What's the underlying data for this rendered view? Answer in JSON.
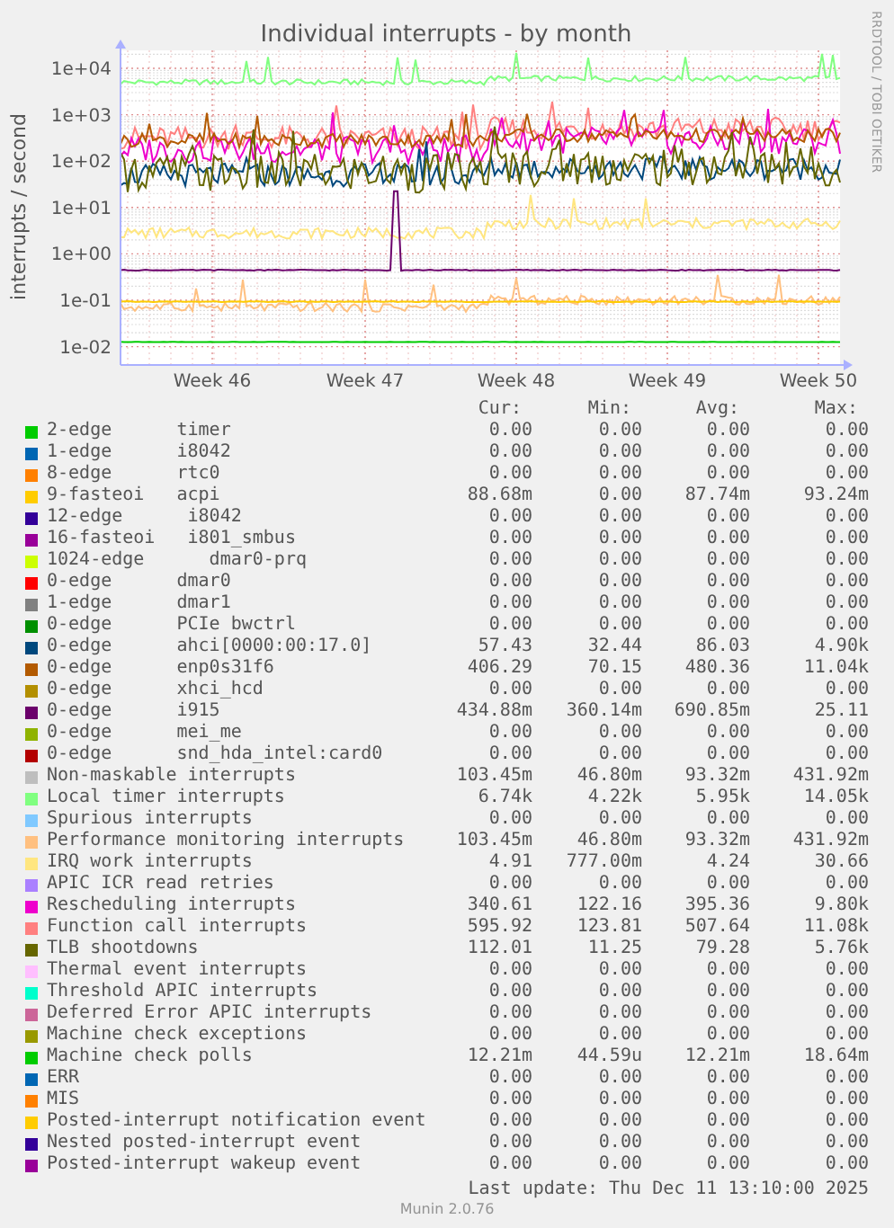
{
  "graph": {
    "title": "Individual interrupts - by month",
    "ylabel": "interrupts / second",
    "side_credit": "RRDTOOL / TOBI OETIKER",
    "yticks": [
      "1e+04",
      "1e+03",
      "1e+02",
      "1e+01",
      "1e+00",
      "1e-01",
      "1e-02"
    ],
    "xticks": [
      "Week 46",
      "Week 47",
      "Week 48",
      "Week 49",
      "Week 50"
    ]
  },
  "legend": {
    "columns": [
      "Cur:",
      "Min:",
      "Avg:",
      "Max:"
    ],
    "rows": [
      {
        "color": "#00cc00",
        "label": "2-edge      timer",
        "cur": "0.00",
        "min": "0.00",
        "avg": "0.00",
        "max": "0.00"
      },
      {
        "color": "#0066b3",
        "label": "1-edge      i8042",
        "cur": "0.00",
        "min": "0.00",
        "avg": "0.00",
        "max": "0.00"
      },
      {
        "color": "#ff8000",
        "label": "8-edge      rtc0",
        "cur": "0.00",
        "min": "0.00",
        "avg": "0.00",
        "max": "0.00"
      },
      {
        "color": "#ffcc00",
        "label": "9-fasteoi   acpi",
        "cur": "88.68m",
        "min": "0.00",
        "avg": "87.74m",
        "max": "93.24m"
      },
      {
        "color": "#330099",
        "label": "12-edge      i8042",
        "cur": "0.00",
        "min": "0.00",
        "avg": "0.00",
        "max": "0.00"
      },
      {
        "color": "#990099",
        "label": "16-fasteoi   i801_smbus",
        "cur": "0.00",
        "min": "0.00",
        "avg": "0.00",
        "max": "0.00"
      },
      {
        "color": "#ccff00",
        "label": "1024-edge      dmar0-prq",
        "cur": "0.00",
        "min": "0.00",
        "avg": "0.00",
        "max": "0.00"
      },
      {
        "color": "#ff0000",
        "label": "0-edge      dmar0",
        "cur": "0.00",
        "min": "0.00",
        "avg": "0.00",
        "max": "0.00"
      },
      {
        "color": "#808080",
        "label": "1-edge      dmar1",
        "cur": "0.00",
        "min": "0.00",
        "avg": "0.00",
        "max": "0.00"
      },
      {
        "color": "#008f00",
        "label": "0-edge      PCIe bwctrl",
        "cur": "0.00",
        "min": "0.00",
        "avg": "0.00",
        "max": "0.00"
      },
      {
        "color": "#00487d",
        "label": "0-edge      ahci[0000:00:17.0]",
        "cur": "57.43",
        "min": "32.44",
        "avg": "86.03",
        "max": "4.90k"
      },
      {
        "color": "#b35a00",
        "label": "0-edge      enp0s31f6",
        "cur": "406.29",
        "min": "70.15",
        "avg": "480.36",
        "max": "11.04k"
      },
      {
        "color": "#b38f00",
        "label": "0-edge      xhci_hcd",
        "cur": "0.00",
        "min": "0.00",
        "avg": "0.00",
        "max": "0.00"
      },
      {
        "color": "#6b006b",
        "label": "0-edge      i915",
        "cur": "434.88m",
        "min": "360.14m",
        "avg": "690.85m",
        "max": "25.11"
      },
      {
        "color": "#8fb300",
        "label": "0-edge      mei_me",
        "cur": "0.00",
        "min": "0.00",
        "avg": "0.00",
        "max": "0.00"
      },
      {
        "color": "#b30000",
        "label": "0-edge      snd_hda_intel:card0",
        "cur": "0.00",
        "min": "0.00",
        "avg": "0.00",
        "max": "0.00"
      },
      {
        "color": "#bebebe",
        "label": "Non-maskable interrupts",
        "cur": "103.45m",
        "min": "46.80m",
        "avg": "93.32m",
        "max": "431.92m"
      },
      {
        "color": "#80ff80",
        "label": "Local timer interrupts",
        "cur": "6.74k",
        "min": "4.22k",
        "avg": "5.95k",
        "max": "14.05k"
      },
      {
        "color": "#80c9ff",
        "label": "Spurious interrupts",
        "cur": "0.00",
        "min": "0.00",
        "avg": "0.00",
        "max": "0.00"
      },
      {
        "color": "#ffc080",
        "label": "Performance monitoring interrupts",
        "cur": "103.45m",
        "min": "46.80m",
        "avg": "93.32m",
        "max": "431.92m"
      },
      {
        "color": "#ffe680",
        "label": "IRQ work interrupts",
        "cur": "4.91",
        "min": "777.00m",
        "avg": "4.24",
        "max": "30.66"
      },
      {
        "color": "#aa80ff",
        "label": "APIC ICR read retries",
        "cur": "0.00",
        "min": "0.00",
        "avg": "0.00",
        "max": "0.00"
      },
      {
        "color": "#ee00cc",
        "label": "Rescheduling interrupts",
        "cur": "340.61",
        "min": "122.16",
        "avg": "395.36",
        "max": "9.80k"
      },
      {
        "color": "#ff8080",
        "label": "Function call interrupts",
        "cur": "595.92",
        "min": "123.81",
        "avg": "507.64",
        "max": "11.08k"
      },
      {
        "color": "#666600",
        "label": "TLB shootdowns",
        "cur": "112.01",
        "min": "11.25",
        "avg": "79.28",
        "max": "5.76k"
      },
      {
        "color": "#ffbfff",
        "label": "Thermal event interrupts",
        "cur": "0.00",
        "min": "0.00",
        "avg": "0.00",
        "max": "0.00"
      },
      {
        "color": "#00ffcc",
        "label": "Threshold APIC interrupts",
        "cur": "0.00",
        "min": "0.00",
        "avg": "0.00",
        "max": "0.00"
      },
      {
        "color": "#cc6699",
        "label": "Deferred Error APIC interrupts",
        "cur": "0.00",
        "min": "0.00",
        "avg": "0.00",
        "max": "0.00"
      },
      {
        "color": "#999900",
        "label": "Machine check exceptions",
        "cur": "0.00",
        "min": "0.00",
        "avg": "0.00",
        "max": "0.00"
      },
      {
        "color": "#00cc00",
        "label": "Machine check polls",
        "cur": "12.21m",
        "min": "44.59u",
        "avg": "12.21m",
        "max": "18.64m"
      },
      {
        "color": "#0066b3",
        "label": "ERR",
        "cur": "0.00",
        "min": "0.00",
        "avg": "0.00",
        "max": "0.00"
      },
      {
        "color": "#ff8000",
        "label": "MIS",
        "cur": "0.00",
        "min": "0.00",
        "avg": "0.00",
        "max": "0.00"
      },
      {
        "color": "#ffcc00",
        "label": "Posted-interrupt notification event",
        "cur": "0.00",
        "min": "0.00",
        "avg": "0.00",
        "max": "0.00"
      },
      {
        "color": "#330099",
        "label": "Nested posted-interrupt event",
        "cur": "0.00",
        "min": "0.00",
        "avg": "0.00",
        "max": "0.00"
      },
      {
        "color": "#990099",
        "label": "Posted-interrupt wakeup event",
        "cur": "0.00",
        "min": "0.00",
        "avg": "0.00",
        "max": "0.00"
      }
    ]
  },
  "last_update": "Last update: Thu Dec 11 13:10:00 2025",
  "version": "Munin 2.0.76"
}
